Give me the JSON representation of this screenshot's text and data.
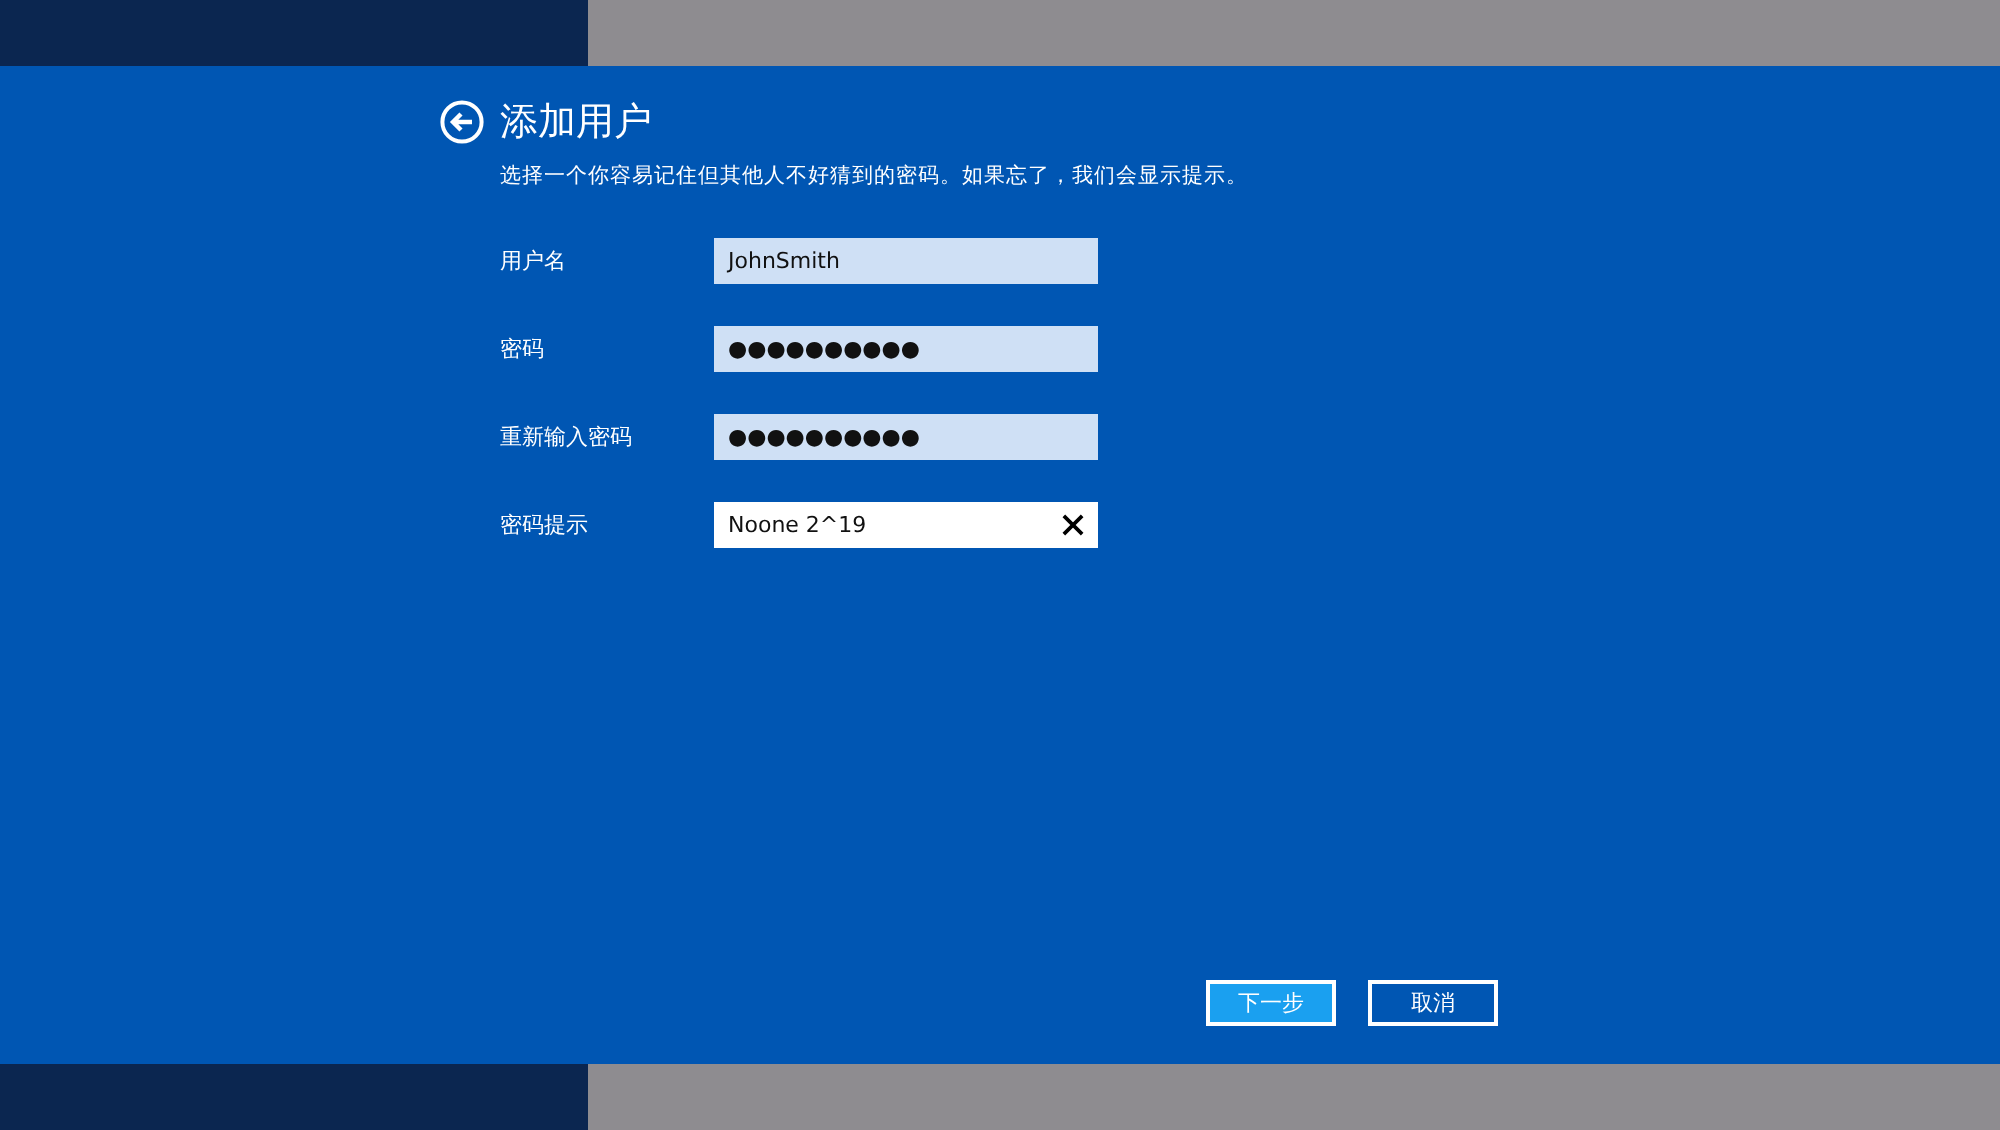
{
  "title": "添加用户",
  "instructions": "选择一个你容易记住但其他人不好猜到的密码。如果忘了，我们会显示提示。",
  "fields": [
    {
      "label": "用户名",
      "value": "JohnSmith",
      "focused": false,
      "clearable": false
    },
    {
      "label": "密码",
      "value": "●●●●●●●●●●",
      "focused": false,
      "clearable": false
    },
    {
      "label": "重新输入密码",
      "value": "●●●●●●●●●●",
      "focused": false,
      "clearable": false
    },
    {
      "label": "密码提示",
      "value": "Noone 2^19",
      "focused": true,
      "clearable": true
    }
  ],
  "buttons": [
    {
      "label": "下一步",
      "primary": true
    },
    {
      "label": "取消",
      "primary": false
    }
  ]
}
